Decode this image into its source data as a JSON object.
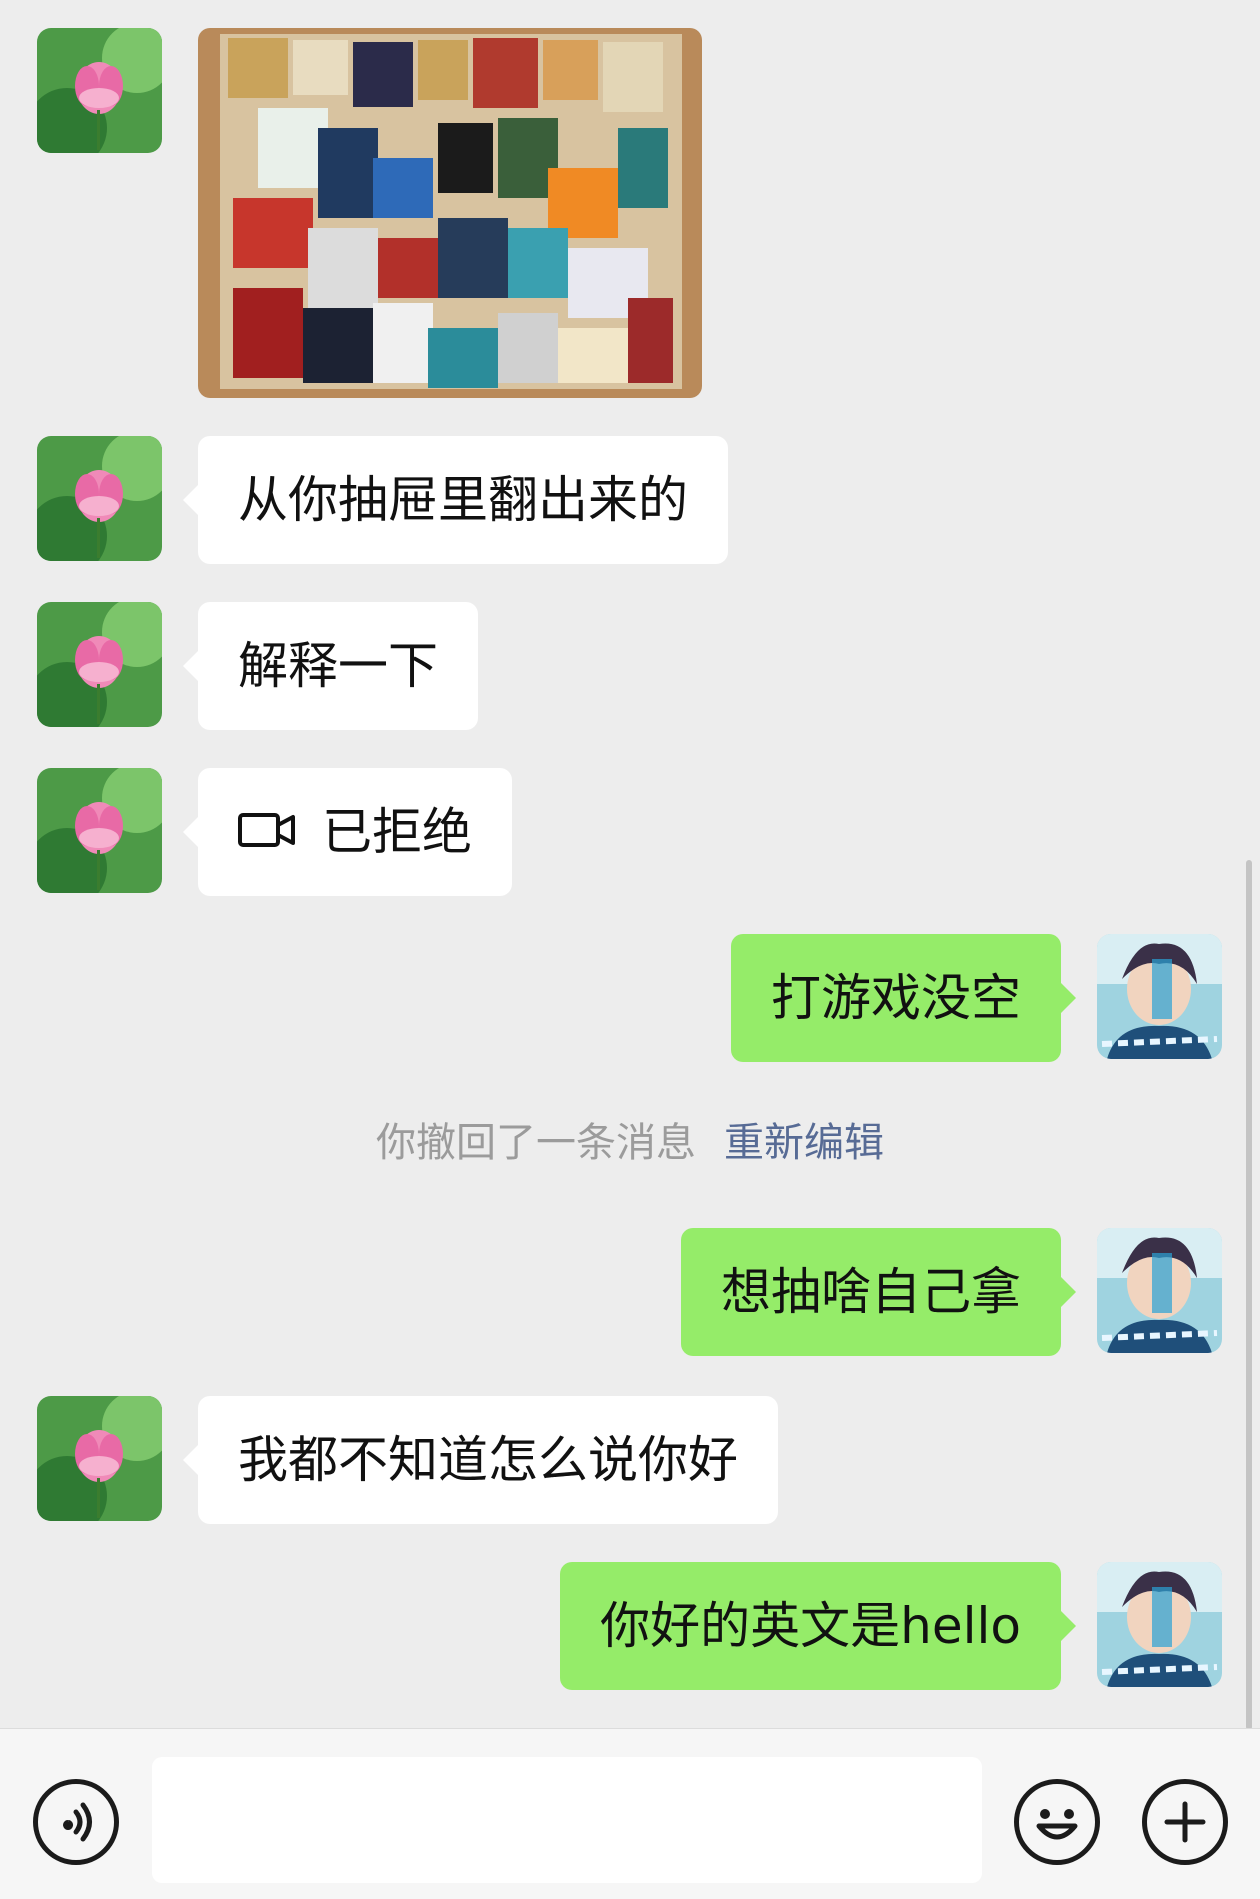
{
  "messages": [
    {
      "from": "contact",
      "type": "image",
      "alt": "photo"
    },
    {
      "from": "contact",
      "type": "text",
      "text": "从你抽屉里翻出来的"
    },
    {
      "from": "contact",
      "type": "text",
      "text": "解释一下"
    },
    {
      "from": "contact",
      "type": "video-call",
      "text": "已拒绝",
      "icon": "video-camera-icon"
    },
    {
      "from": "me",
      "type": "text",
      "text": "打游戏没空"
    },
    {
      "from": "me",
      "type": "text",
      "text": "想抽啥自己拿"
    },
    {
      "from": "contact",
      "type": "text",
      "text": "我都不知道怎么说你好"
    },
    {
      "from": "me",
      "type": "text",
      "text": "你好的英文是hello"
    }
  ],
  "recall_notice": {
    "text": "你撤回了一条消息",
    "action": "重新编辑"
  },
  "input_bar": {
    "placeholder": "",
    "voice_icon": "voice-icon",
    "emoji_icon": "emoji-icon",
    "plus_icon": "plus-icon"
  },
  "colors": {
    "background": "#ededed",
    "incoming_bubble": "#ffffff",
    "outgoing_bubble": "#95ec69",
    "link": "#576b95"
  }
}
